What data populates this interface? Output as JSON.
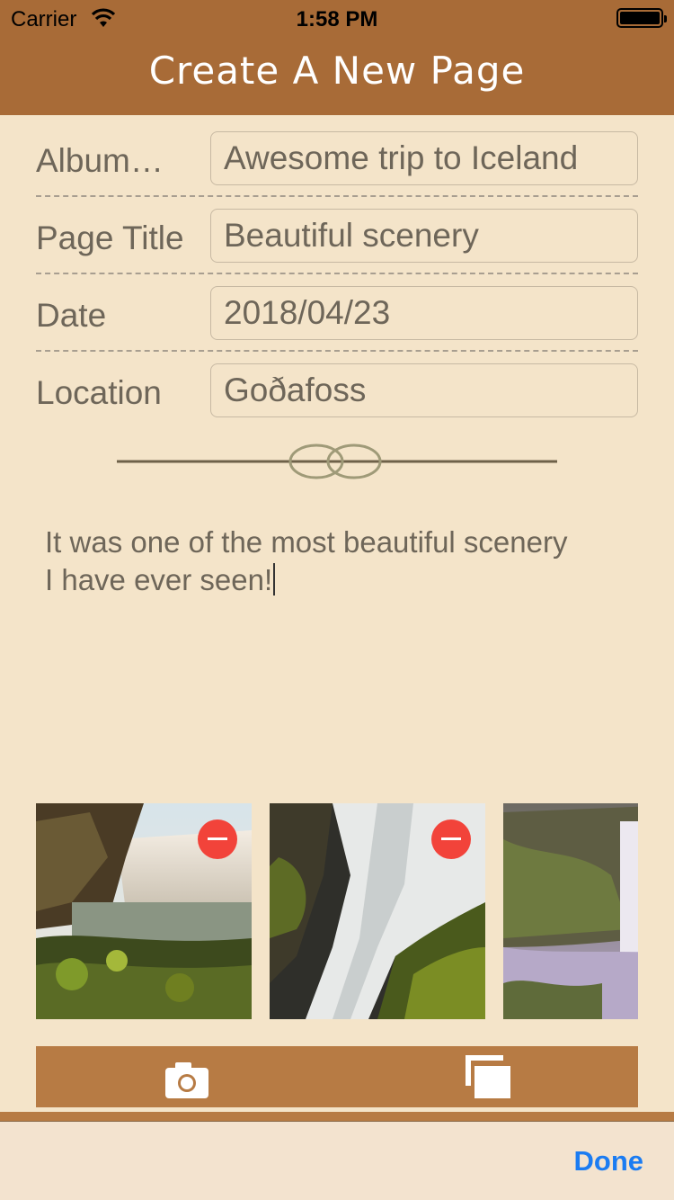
{
  "status_bar": {
    "carrier": "Carrier",
    "time": "1:58 PM"
  },
  "nav": {
    "title": "Create A New Page"
  },
  "form": {
    "album": {
      "label": "Album…",
      "value": "Awesome trip to Iceland"
    },
    "page_title": {
      "label": "Page Title",
      "value": "Beautiful scenery"
    },
    "date": {
      "label": "Date",
      "value": "2018/04/23"
    },
    "location": {
      "label": "Location",
      "value": "Goðafoss"
    }
  },
  "body": {
    "line1": "It was one of the most beautiful scenery",
    "line2": "I have ever seen!"
  },
  "photos": [
    {
      "name": "waterfall-photo-1",
      "removable": true
    },
    {
      "name": "waterfall-photo-2",
      "removable": true
    },
    {
      "name": "waterfall-photo-3",
      "removable": false
    }
  ],
  "toolbar": {
    "icons": [
      "camera-icon",
      "photo-library-icon"
    ]
  },
  "keyboard_bar": {
    "done_label": "Done"
  },
  "colors": {
    "nav": "#a86b37",
    "background": "#f4e4c9",
    "toolbar": "#b77b44",
    "accent": "#1b7cf2",
    "remove": "#f2433a"
  }
}
